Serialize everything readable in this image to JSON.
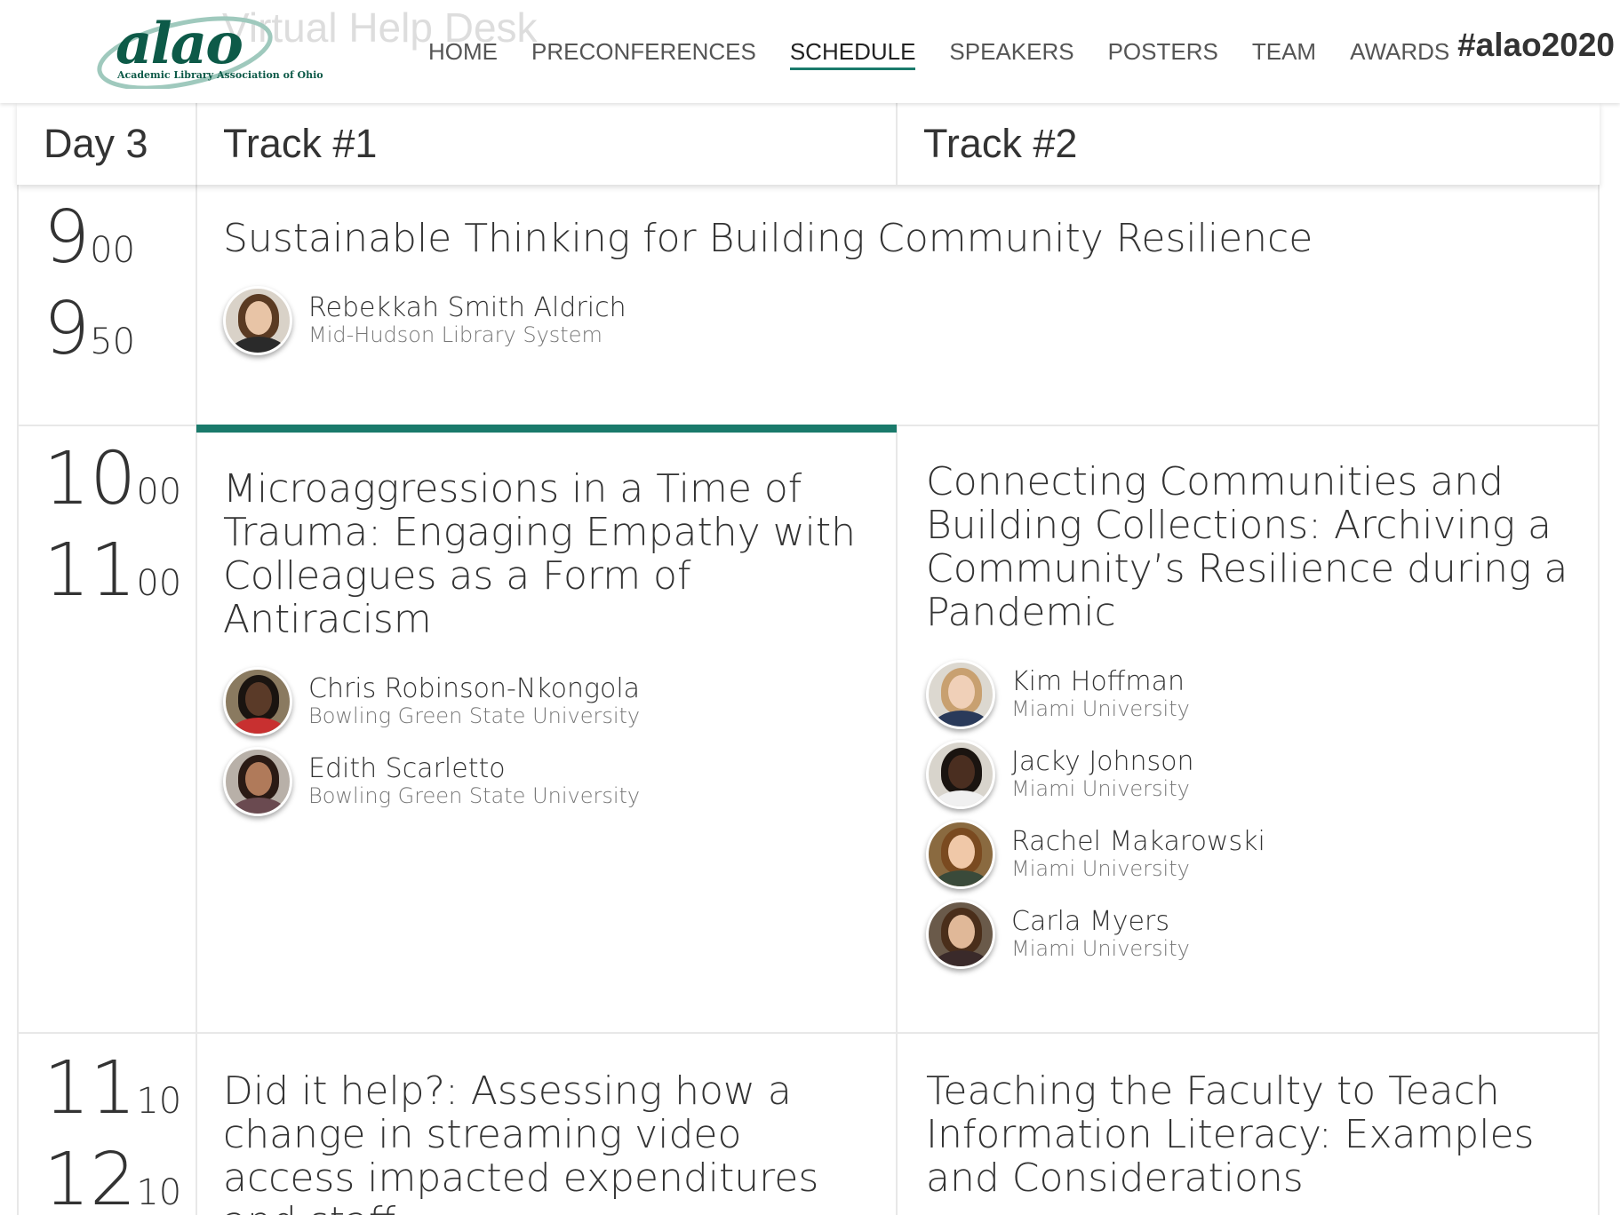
{
  "header": {
    "logo_text": "alao",
    "logo_subtext": "Academic Library Association of Ohio",
    "tagline": "Virtual Help Desk",
    "nav": [
      {
        "label": "HOME",
        "active": false
      },
      {
        "label": "PRECONFERENCES",
        "active": false
      },
      {
        "label": "SCHEDULE",
        "active": true
      },
      {
        "label": "SPEAKERS",
        "active": false
      },
      {
        "label": "POSTERS",
        "active": false
      },
      {
        "label": "TEAM",
        "active": false
      },
      {
        "label": "AWARDS",
        "active": false
      }
    ],
    "hashtag": "#alao2020"
  },
  "table": {
    "day_label": "Day 3",
    "track1_label": "Track #1",
    "track2_label": "Track #2"
  },
  "slots": [
    {
      "start_h": "9",
      "start_m": "00",
      "end_h": "9",
      "end_m": "50",
      "plenary": {
        "title": "Sustainable Thinking for Building Community Resilience",
        "speakers": [
          {
            "name": "Rebekkah Smith Aldrich",
            "org": "Mid-Hudson Library System"
          }
        ]
      }
    },
    {
      "start_h": "10",
      "start_m": "00",
      "end_h": "11",
      "end_m": "00",
      "track1": {
        "title": "Microaggressions in a Time of Trauma: Engaging Empathy with Colleagues as a Form of Antiracism",
        "speakers": [
          {
            "name": "Chris Robinson-Nkongola",
            "org": "Bowling Green State University"
          },
          {
            "name": "Edith Scarletto",
            "org": "Bowling Green State University"
          }
        ]
      },
      "track2": {
        "title": "Connecting Communities and Building Collections: Archiving a Community’s Resilience during a Pandemic",
        "speakers": [
          {
            "name": "Kim Hoffman",
            "org": "Miami University"
          },
          {
            "name": "Jacky Johnson",
            "org": "Miami University"
          },
          {
            "name": "Rachel Makarowski",
            "org": "Miami University"
          },
          {
            "name": "Carla Myers",
            "org": "Miami University"
          }
        ]
      }
    },
    {
      "start_h": "11",
      "start_m": "10",
      "end_h": "12",
      "end_m": "10",
      "track1": {
        "title": "Did it help?: Assessing how a change in streaming video access impacted expenditures and staff"
      },
      "track2": {
        "title": "Teaching the Faculty to Teach Information Literacy: Examples and Considerations"
      }
    }
  ],
  "colors": {
    "accent": "#1a7a6b",
    "logo": "#0d5a48"
  }
}
